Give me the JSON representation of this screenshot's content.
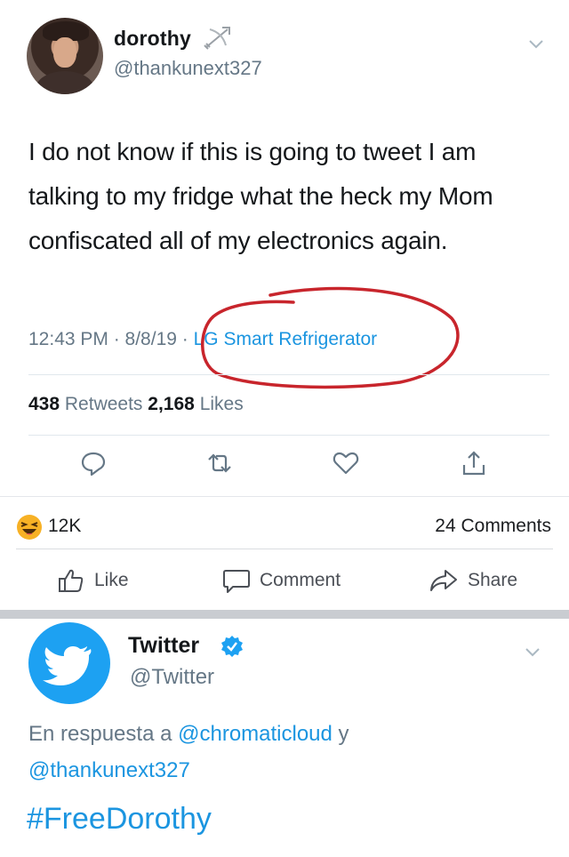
{
  "tweet": {
    "display_name": "dorothy",
    "name_emoji": "bow-and-arrow-icon",
    "handle": "@thankunext327",
    "text": "I do not know if this is going to tweet I am talking to my fridge what the heck my Mom confiscated all of my electronics again.",
    "timestamp": "12:43 PM · 8/8/19",
    "source_sep": " · ",
    "source": "LG Smart Refrigerator",
    "retweets_count": "438",
    "retweets_label": "Retweets",
    "likes_count": "2,168",
    "likes_label": "Likes",
    "annotation_color": "#c8252c"
  },
  "facebook": {
    "reaction_emoji": "laughing-emoji-icon",
    "reaction_count": "12K",
    "comment_count": "24 Comments",
    "actions": {
      "like": "Like",
      "comment": "Comment",
      "share": "Share"
    }
  },
  "reply": {
    "display_name": "Twitter",
    "verified": true,
    "handle": "@Twitter",
    "replying_prefix": "En respuesta a",
    "mention_1": "@chromaticloud",
    "connector": "y",
    "mention_2": "@thankunext327",
    "hashtag": "#FreeDorothy"
  },
  "colors": {
    "twitter_blue": "#1da1f2",
    "link_blue": "#1b95e0",
    "secondary_gray": "#657786"
  }
}
